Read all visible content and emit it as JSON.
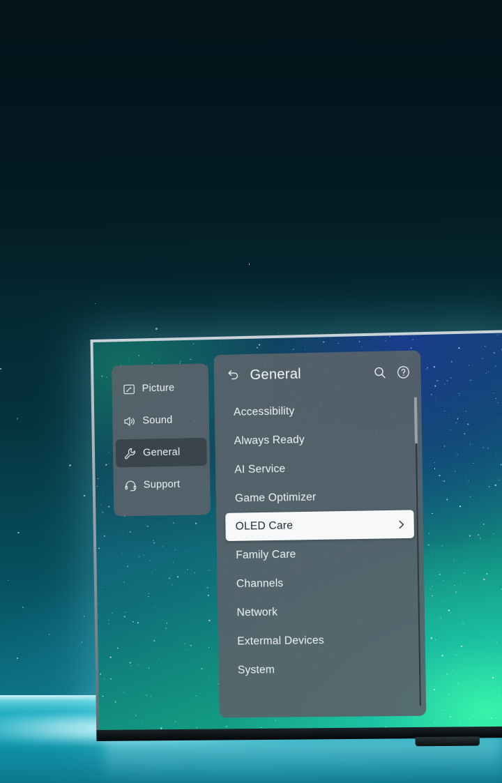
{
  "scene": {
    "device": "tv",
    "wallpaper": "starfield-aurora",
    "accent_glow": "#7ceef9",
    "panel_bg": "#58636a",
    "selected_row_bg": "#f6f8f9",
    "selected_row_text": "#222b30",
    "text_color": "#eef3f5"
  },
  "settings": {
    "categories": [
      {
        "label": "Picture",
        "icon": "picture-icon",
        "selected": false
      },
      {
        "label": "Sound",
        "icon": "speaker-icon",
        "selected": false
      },
      {
        "label": "General",
        "icon": "wrench-icon",
        "selected": true
      },
      {
        "label": "Support",
        "icon": "headset-icon",
        "selected": false
      }
    ],
    "panel": {
      "back_icon": "back-arrow-icon",
      "title": "General",
      "search_icon": "search-icon",
      "help_icon": "help-circle-icon",
      "items": [
        {
          "label": "Accessibility",
          "selected": false,
          "chevron": false
        },
        {
          "label": "Always Ready",
          "selected": false,
          "chevron": false
        },
        {
          "label": "AI Service",
          "selected": false,
          "chevron": false
        },
        {
          "label": "Game Optimizer",
          "selected": false,
          "chevron": false
        },
        {
          "label": "OLED Care",
          "selected": true,
          "chevron": true
        },
        {
          "label": "Family Care",
          "selected": false,
          "chevron": false
        },
        {
          "label": "Channels",
          "selected": false,
          "chevron": false
        },
        {
          "label": "Network",
          "selected": false,
          "chevron": false
        },
        {
          "label": "Extermal Devices",
          "selected": false,
          "chevron": false
        },
        {
          "label": "System",
          "selected": false,
          "chevron": false
        }
      ]
    }
  }
}
